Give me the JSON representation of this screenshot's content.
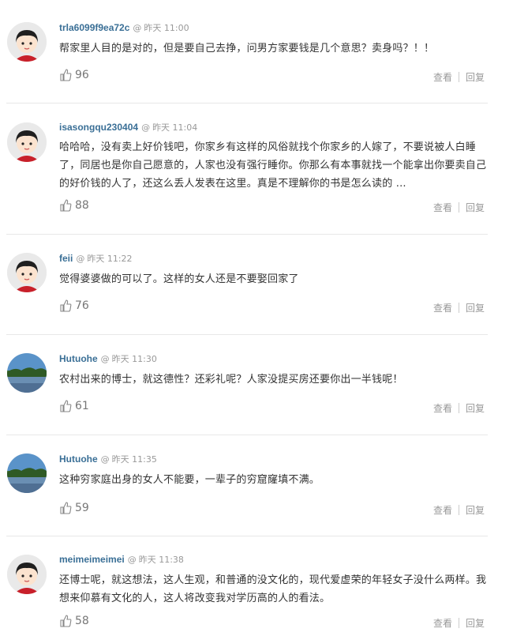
{
  "comments": [
    {
      "user": "trla6099f9ea72c",
      "at": "@",
      "time": "昨天 11:00",
      "text": "帮家里人目的是对的，但是要自己去挣，问男方家要钱是几个意思？卖身吗？！！",
      "likes": "96",
      "avatar": "cartoon-girl-icon"
    },
    {
      "user": "isasongqu230404",
      "at": "@",
      "time": "昨天 11:04",
      "text": "哈哈哈，没有卖上好价钱吧，你家乡有这样的风俗就找个你家乡的人嫁了，不要说被人白睡了，同居也是你自己愿意的，人家也没有强行睡你。你那么有本事就找一个能拿出你要卖自己的好价钱的人了，还这么丢人发表在这里。真是不理解你的书是怎么读的 ...",
      "likes": "88",
      "avatar": "cartoon-girl-icon"
    },
    {
      "user": "feii",
      "at": "@",
      "time": "昨天 11:22",
      "text": "觉得婆婆做的可以了。这样的女人还是不要娶回家了",
      "likes": "76",
      "avatar": "cartoon-girl-icon"
    },
    {
      "user": "Hutuohe",
      "at": "@",
      "time": "昨天 11:30",
      "text": "农村出来的博士，就这德性？还彩礼呢？人家没提买房还要你出一半钱呢！",
      "likes": "61",
      "avatar": "landscape-photo-icon"
    },
    {
      "user": "Hutuohe",
      "at": "@",
      "time": "昨天 11:35",
      "text": "这种穷家庭出身的女人不能要，一辈子的穷窟窿填不满。",
      "likes": "59",
      "avatar": "landscape-photo-icon"
    },
    {
      "user": "meimeimeimei",
      "at": "@",
      "time": "昨天 11:38",
      "text": "还博士呢，就这想法，这人生观，和普通的没文化的，现代爱虚荣的年轻女子没什么两样。我想来仰慕有文化的人，这人将改变我对学历高的人的看法。",
      "likes": "58",
      "avatar": "cartoon-girl-icon"
    }
  ],
  "actions": {
    "view": "查看",
    "reply": "回复"
  },
  "icons": {
    "like": "thumbs-up-icon"
  },
  "colors": {
    "username": "#3a6f96",
    "meta": "#999999",
    "text": "#333333",
    "separator": "#e8e8e8"
  }
}
